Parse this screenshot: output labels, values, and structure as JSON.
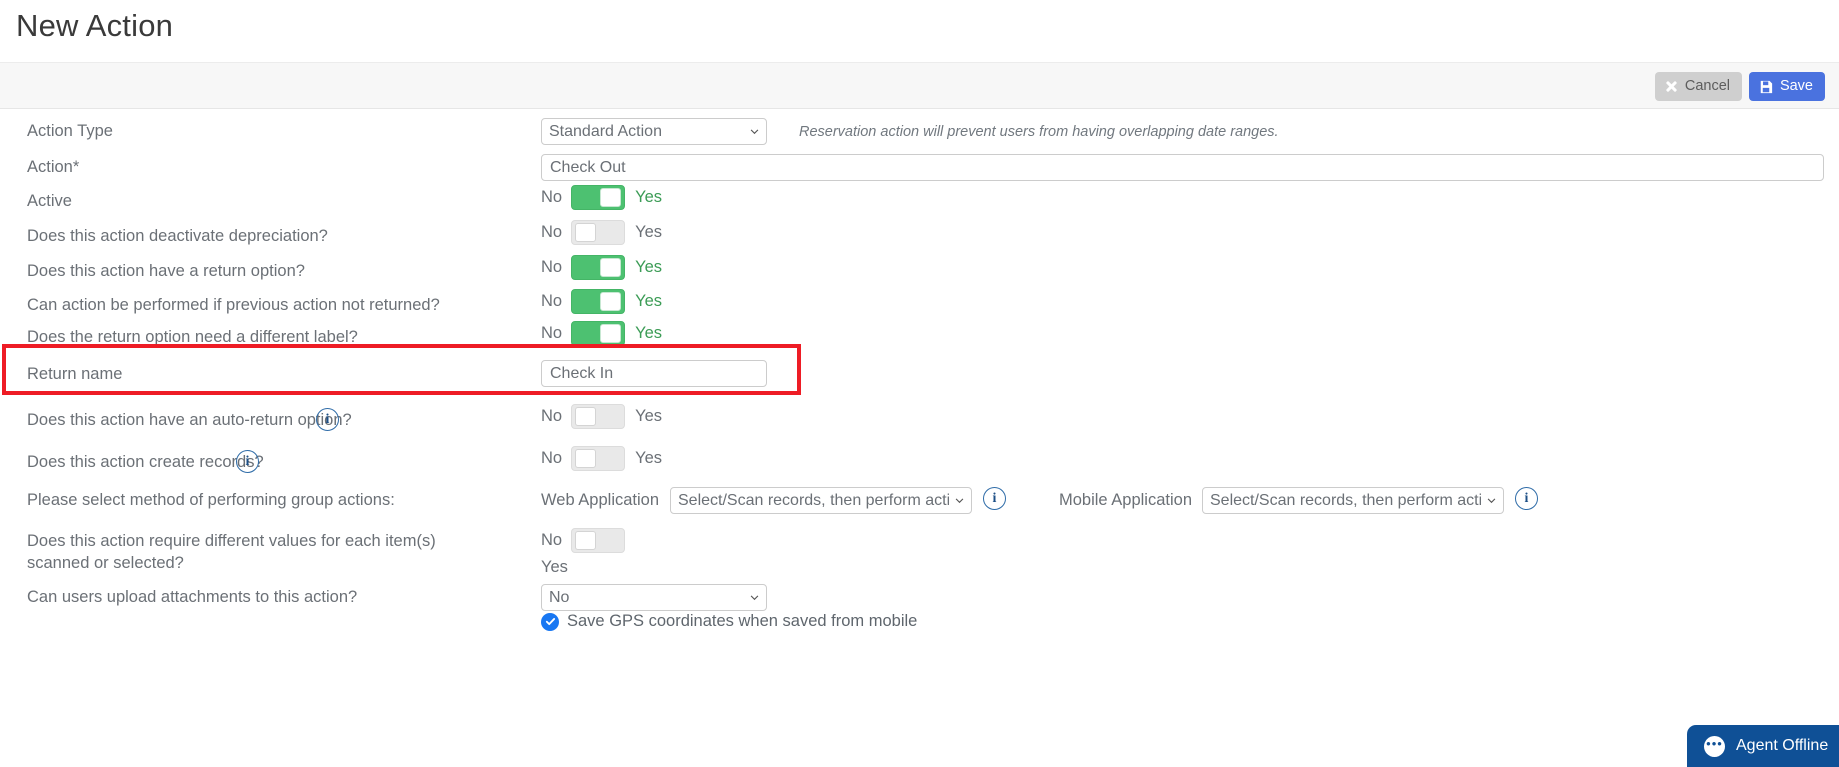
{
  "header": {
    "title": "New Action"
  },
  "toolbar": {
    "cancel_label": "Cancel",
    "save_label": "Save",
    "cancel_icon": "close-icon",
    "save_icon": "floppy-disk-icon",
    "save_color": "#4a72df",
    "cancel_color": "#cfcfcf"
  },
  "form": {
    "action_type": {
      "label": "Action Type",
      "value": "Standard Action",
      "hint": "Reservation action will prevent users from having overlapping date ranges."
    },
    "action_name": {
      "label": "Action*",
      "value": "Check Out"
    },
    "active": {
      "label": "Active",
      "no": "No",
      "yes": "Yes",
      "state": "on"
    },
    "deactivate_depreciation": {
      "label": "Does this action deactivate depreciation?",
      "no": "No",
      "yes": "Yes",
      "state": "off"
    },
    "return_option": {
      "label": "Does this action have a return option?",
      "no": "No",
      "yes": "Yes",
      "state": "on"
    },
    "previous_not_returned": {
      "label": "Can action be performed if previous action not returned?",
      "no": "No",
      "yes": "Yes",
      "state": "on"
    },
    "return_different_label": {
      "label": "Does the return option need a different label?",
      "no": "No",
      "yes": "Yes",
      "state": "on"
    },
    "return_name": {
      "label": "Return name",
      "value": "Check In"
    },
    "auto_return": {
      "label": "Does this action have an auto-return option?",
      "no": "No",
      "yes": "Yes",
      "state": "off",
      "info_icon": "info-icon"
    },
    "create_records": {
      "label": "Does this action create records?",
      "no": "No",
      "yes": "Yes",
      "state": "off",
      "info_icon": "info-icon"
    },
    "group_actions": {
      "label": "Please select method of performing group actions:",
      "web_label": "Web Application",
      "web_value": "Select/Scan records, then perform action",
      "mobile_label": "Mobile Application",
      "mobile_value": "Select/Scan records, then perform action",
      "info_icon": "info-icon"
    },
    "different_values": {
      "label": "Does this action require different values for each item(s) scanned or selected?",
      "no": "No",
      "yes": "Yes",
      "state": "off"
    },
    "attachments": {
      "label": "Can users upload attachments to this action?",
      "value": "No"
    },
    "gps": {
      "label": "Save GPS coordinates when saved from mobile",
      "checked": true,
      "color": "#1877f2"
    }
  },
  "annotation": {
    "highlight_color": "#ee1c25",
    "target": "return-name-row"
  },
  "chat": {
    "status": "Agent Offline",
    "icon": "chat-bubble-icon",
    "color": "#0f5096"
  }
}
